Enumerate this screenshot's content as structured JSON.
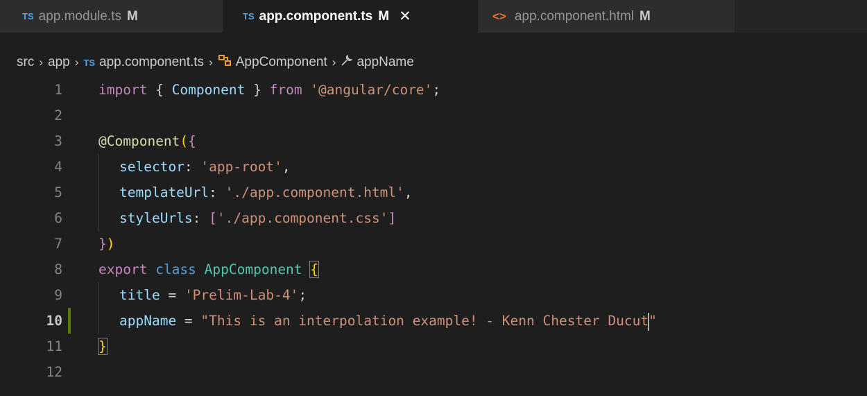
{
  "tabs": [
    {
      "prefix": "TS",
      "label": "app.module.ts",
      "status": "M"
    },
    {
      "prefix": "TS",
      "label": "app.component.ts",
      "status": "M",
      "close": "✕"
    },
    {
      "prefix": "<>",
      "label": "app.component.html",
      "status": "M"
    }
  ],
  "breadcrumb": {
    "folder1": "src",
    "folder2": "app",
    "file_prefix": "TS",
    "file": "app.component.ts",
    "class": "AppComponent",
    "property": "appName",
    "separator": "›"
  },
  "editor": {
    "line_numbers": [
      "1",
      "2",
      "3",
      "4",
      "5",
      "6",
      "7",
      "8",
      "9",
      "10",
      "11",
      "12"
    ],
    "current_line": "10",
    "code": {
      "l1": {
        "import": "import",
        "open": " { ",
        "component": "Component",
        "close": " } ",
        "from": "from",
        "space": " ",
        "path": "'@angular/core'",
        "semi": ";"
      },
      "l3": {
        "at": "@",
        "decorator": "Component",
        "paren": "(",
        "brace": "{"
      },
      "l4": {
        "key": "selector",
        "colon": ": ",
        "value": "'app-root'",
        "comma": ","
      },
      "l5": {
        "key": "templateUrl",
        "colon": ": ",
        "value": "'./app.component.html'",
        "comma": ","
      },
      "l6": {
        "key": "styleUrls",
        "colon": ": ",
        "open": "[",
        "value": "'./app.component.css'",
        "close": "]"
      },
      "l7": {
        "brace": "}",
        "paren": ")"
      },
      "l8": {
        "export": "export",
        "class_kw": "class",
        "name": "AppComponent",
        "brace": "{"
      },
      "l9": {
        "key": "title",
        "eq": " = ",
        "value": "'Prelim-Lab-4'",
        "semi": ";"
      },
      "l10": {
        "key": "appName",
        "eq": " = ",
        "value_before_cursor": "\"This is an interpolation example! - Kenn Chester Ducut",
        "value_after_cursor": "\""
      },
      "l11": {
        "brace": "}"
      }
    }
  }
}
